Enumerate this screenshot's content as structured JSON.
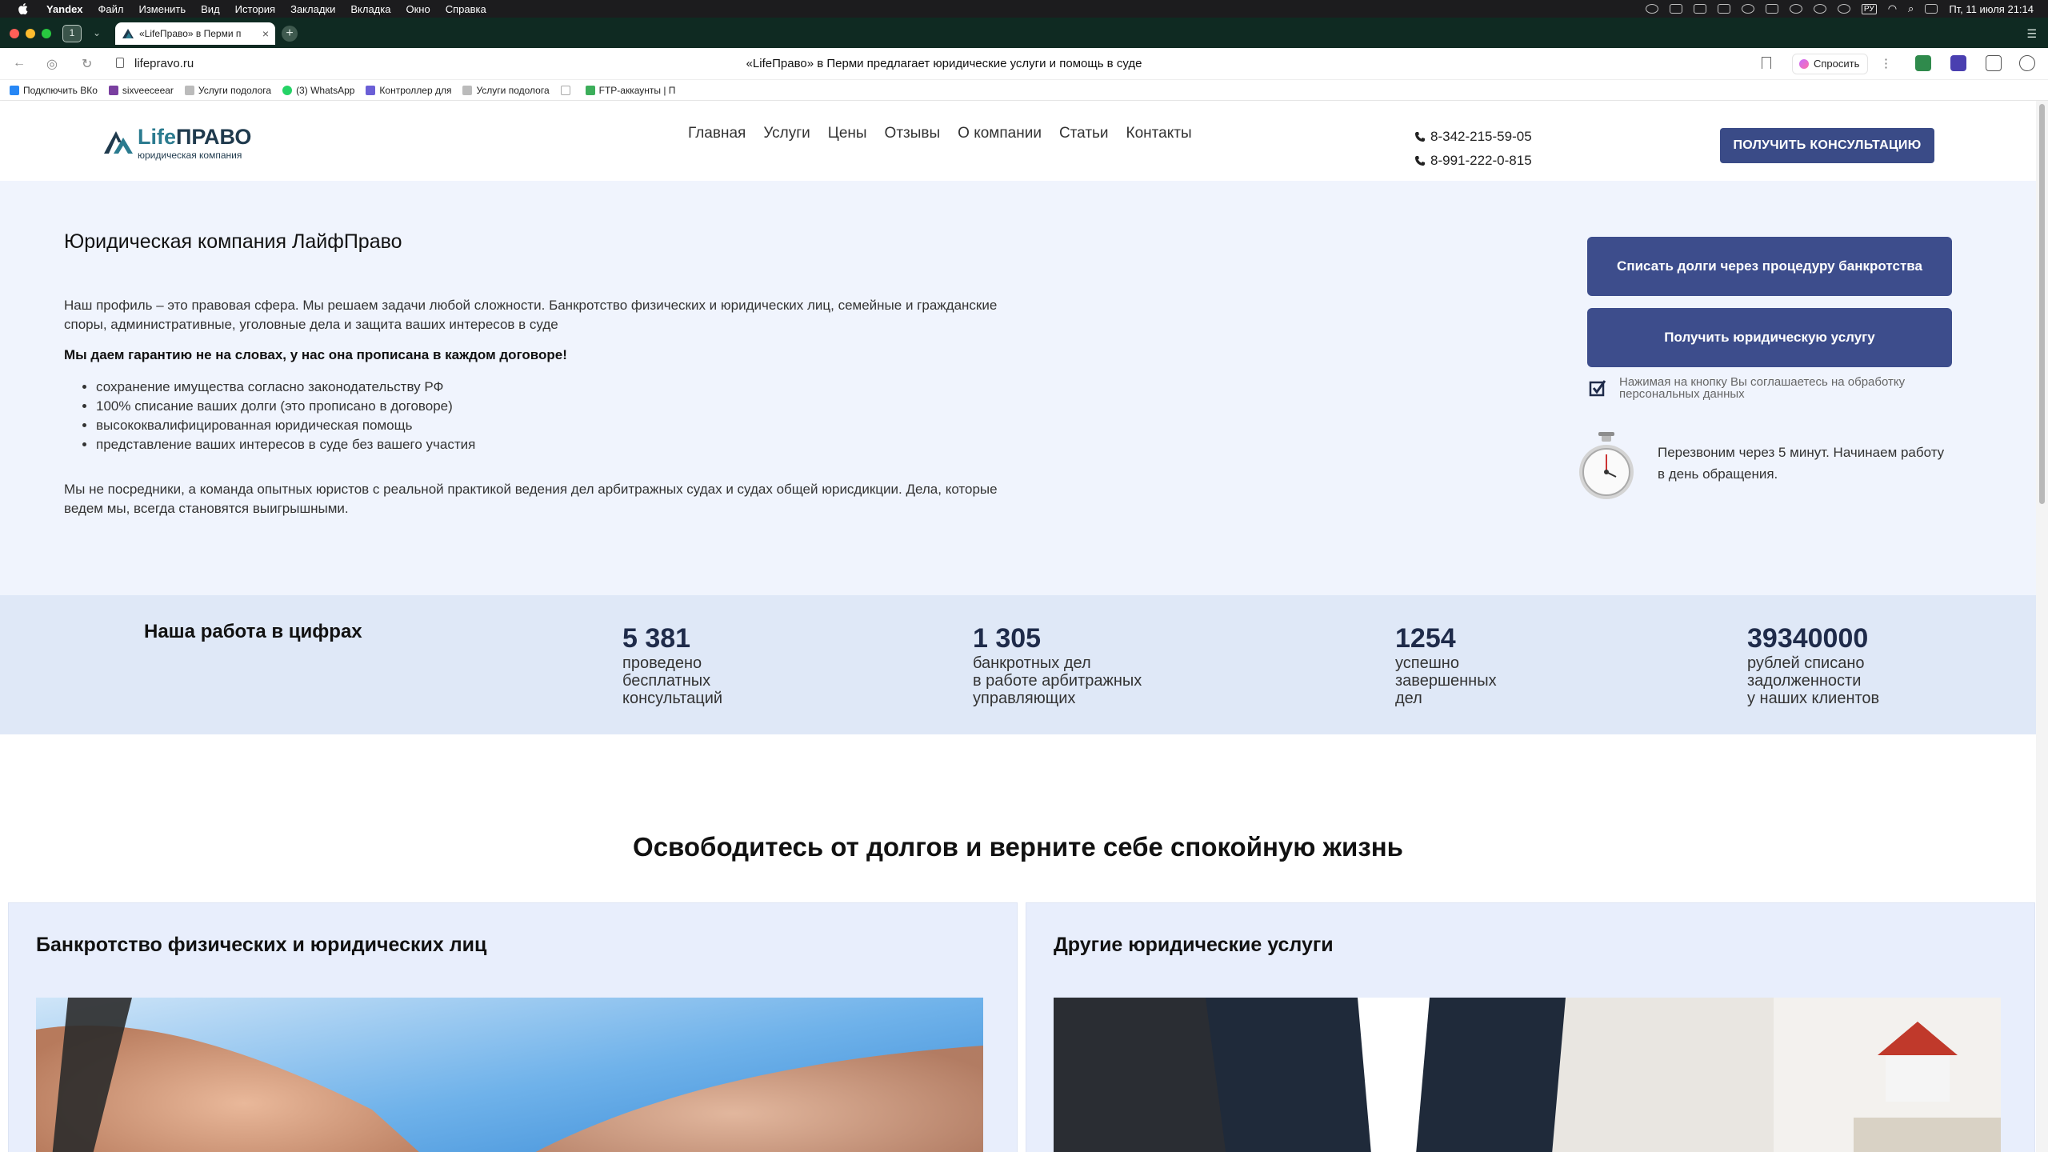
{
  "menubar": {
    "app": "Yandex",
    "items": [
      "Файл",
      "Изменить",
      "Вид",
      "История",
      "Закладки",
      "Вкладка",
      "Окно",
      "Справка"
    ],
    "lang": "РУ",
    "clock": "Пт, 11 июля  21:14"
  },
  "browser": {
    "tab_count": "1",
    "tab_title": "«LifeПраво» в Перми п",
    "url": "lifepravo.ru",
    "page_title": "«LifeПраво» в Перми предлагает юридические услуги и помощь в суде",
    "ask_label": "Спросить"
  },
  "bookmarks": [
    {
      "label": "Подключить ВКо"
    },
    {
      "label": "sixveeceear"
    },
    {
      "label": "Услуги подолога"
    },
    {
      "label": "(3) WhatsApp"
    },
    {
      "label": "Контроллер для"
    },
    {
      "label": "Услуги подолога"
    },
    {
      "label": "FTP-аккаунты | П"
    }
  ],
  "site": {
    "logo": {
      "life": "Life",
      "pravo": "ПРАВО",
      "tagline": "юридическая компания"
    },
    "nav": [
      "Главная",
      "Услуги",
      "Цены",
      "Отзывы",
      "О компании",
      "Статьи",
      "Контакты"
    ],
    "phones": [
      "8-342-215-59-05",
      "8-991-222-0-815"
    ],
    "cta": "ПОЛУЧИТЬ КОНСУЛЬТАЦИЮ"
  },
  "hero": {
    "title": "Юридическая компания ЛайфПраво",
    "intro": "Наш профиль – это правовая сфера. Мы решаем задачи любой сложности. Банкротство физических и юридических лиц, семейные и гражданские споры, административные, уголовные дела и защита ваших интересов в суде",
    "guarantee": "Мы даем гарантию не на словах, у нас она прописана в каждом договоре!",
    "bullets": [
      "сохранение имущества согласно законодательству РФ",
      "100% списание ваших долги (это прописано в договоре)",
      "высококвалифицированная юридическая помощь",
      "представление ваших интересов в суде без вашего участия"
    ],
    "outro": "Мы не посредники, а команда опытных юристов с реальной практикой ведения дел арбитражных судах и судах общей юрисдикции. Дела, которые ведем мы, всегда становятся выигрышными.",
    "btn_bankruptcy": "Списать долги через процедуру банкротства",
    "btn_service": "Получить юридическую услугу",
    "agree_text": "Нажимая на кнопку Вы соглашаетесь на обработку персональных данных",
    "callback_text": "Перезвоним через 5 минут. Начинаем работу в день обращения."
  },
  "numbers": {
    "title": "Наша работа в цифрах",
    "stats": [
      {
        "value": "5 381",
        "label": "проведено\nбесплатных\nконсультаций"
      },
      {
        "value": "1 305",
        "label": "банкротных дел\nв работе арбитражных\nуправляющих"
      },
      {
        "value": "1254",
        "label": "успешно\nзавершенных\nдел"
      },
      {
        "value": "39340000",
        "label": "рублей списано\nзадолженности\nу наших клиентов"
      }
    ]
  },
  "debts": {
    "title_regular": "Освободитесь от долгов и ",
    "title_bold": "верните себе спокойную жизнь",
    "cards": [
      {
        "title": "Банкротство физических и юридических лиц"
      },
      {
        "title": "Другие юридические услуги"
      }
    ]
  },
  "colors": {
    "accent": "#3d4d8c",
    "hero_bg": "#f0f4fd",
    "numbers_bg": "#dfe8f7",
    "card_bg": "#e8eefc"
  }
}
